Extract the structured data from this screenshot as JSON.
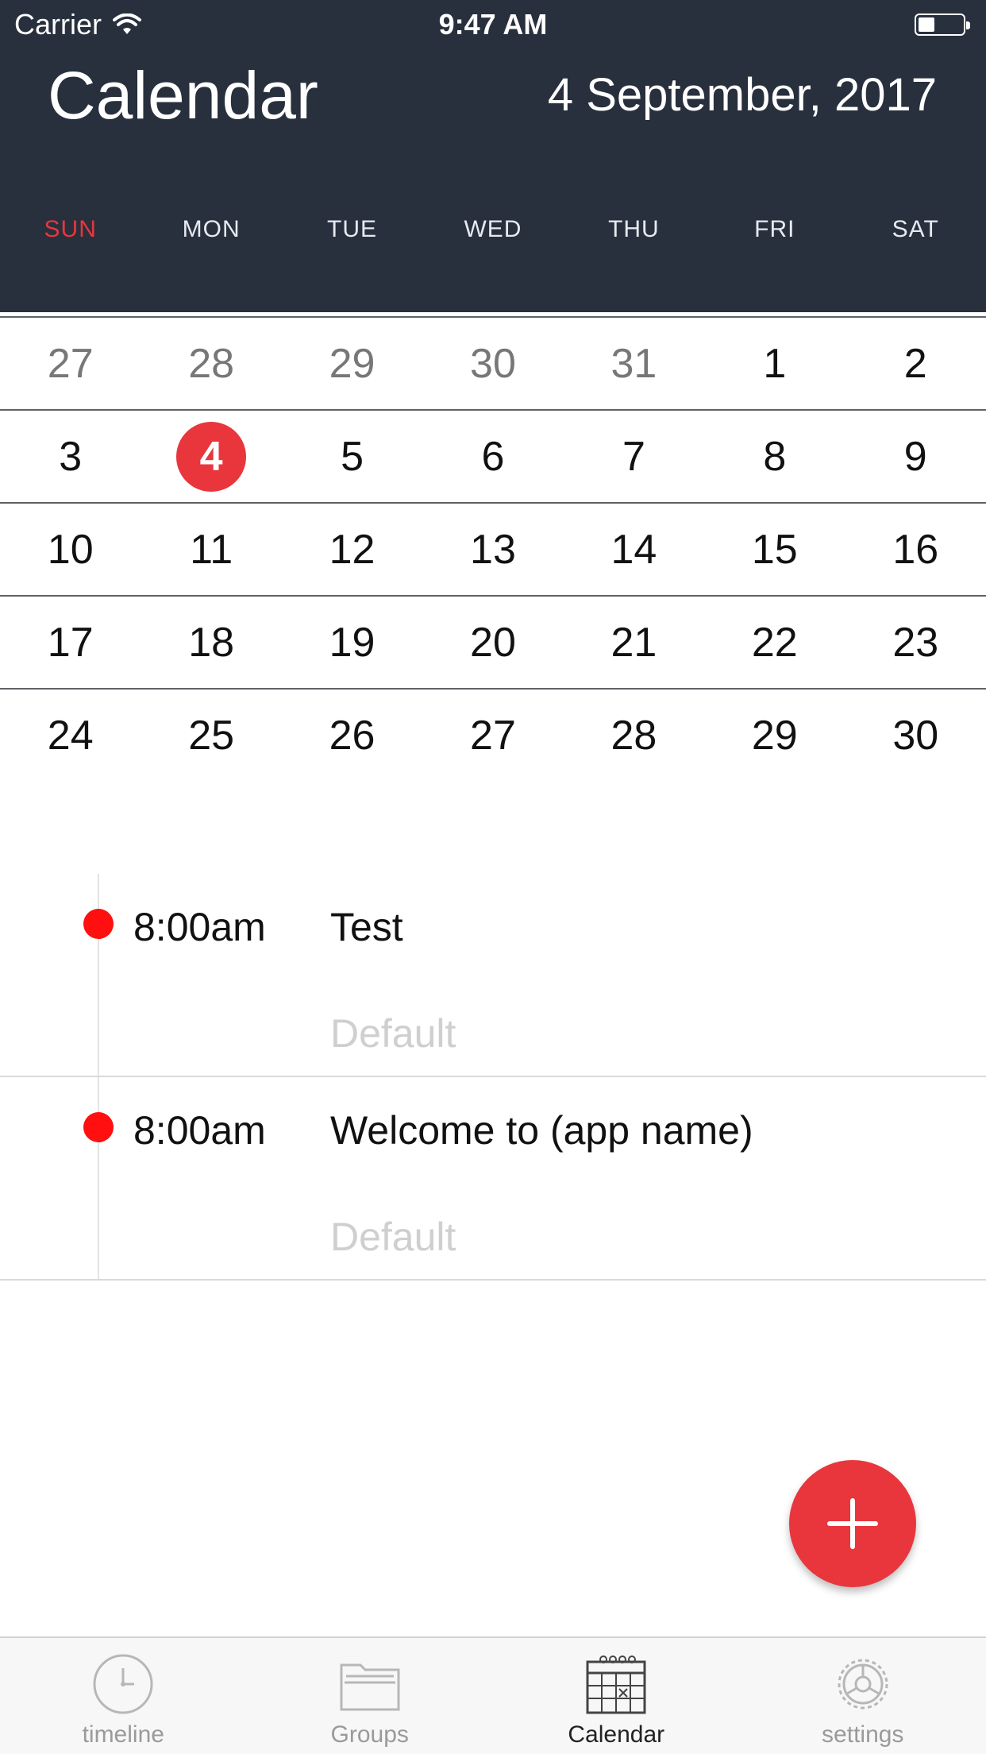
{
  "status_bar": {
    "carrier": "Carrier",
    "time": "9:47 AM"
  },
  "header": {
    "title": "Calendar",
    "date": "4 September, 2017"
  },
  "weekdays": [
    "SUN",
    "MON",
    "TUE",
    "WED",
    "THU",
    "FRI",
    "SAT"
  ],
  "calendar": {
    "weeks": [
      [
        "27",
        "28",
        "29",
        "30",
        "31",
        "1",
        "2"
      ],
      [
        "3",
        "4",
        "5",
        "6",
        "7",
        "8",
        "9"
      ],
      [
        "10",
        "11",
        "12",
        "13",
        "14",
        "15",
        "16"
      ],
      [
        "17",
        "18",
        "19",
        "20",
        "21",
        "22",
        "23"
      ],
      [
        "24",
        "25",
        "26",
        "27",
        "28",
        "29",
        "30"
      ]
    ],
    "selected_day": "4"
  },
  "events": [
    {
      "time": "8:00am",
      "title": "Test",
      "group": "Default"
    },
    {
      "time": "8:00am",
      "title": "Welcome to (app name)",
      "group": "Default"
    }
  ],
  "fab": {
    "icon": "plus-icon"
  },
  "tabbar": {
    "tabs": [
      {
        "label": "timeline",
        "icon": "clock-icon"
      },
      {
        "label": "Groups",
        "icon": "folder-icon"
      },
      {
        "label": "Calendar",
        "icon": "calendar-icon"
      },
      {
        "label": "settings",
        "icon": "gear-icon"
      }
    ]
  },
  "colors": {
    "header_bg": "#28303d",
    "accent": "#e8363c",
    "event_dot": "#ff0f0f"
  }
}
